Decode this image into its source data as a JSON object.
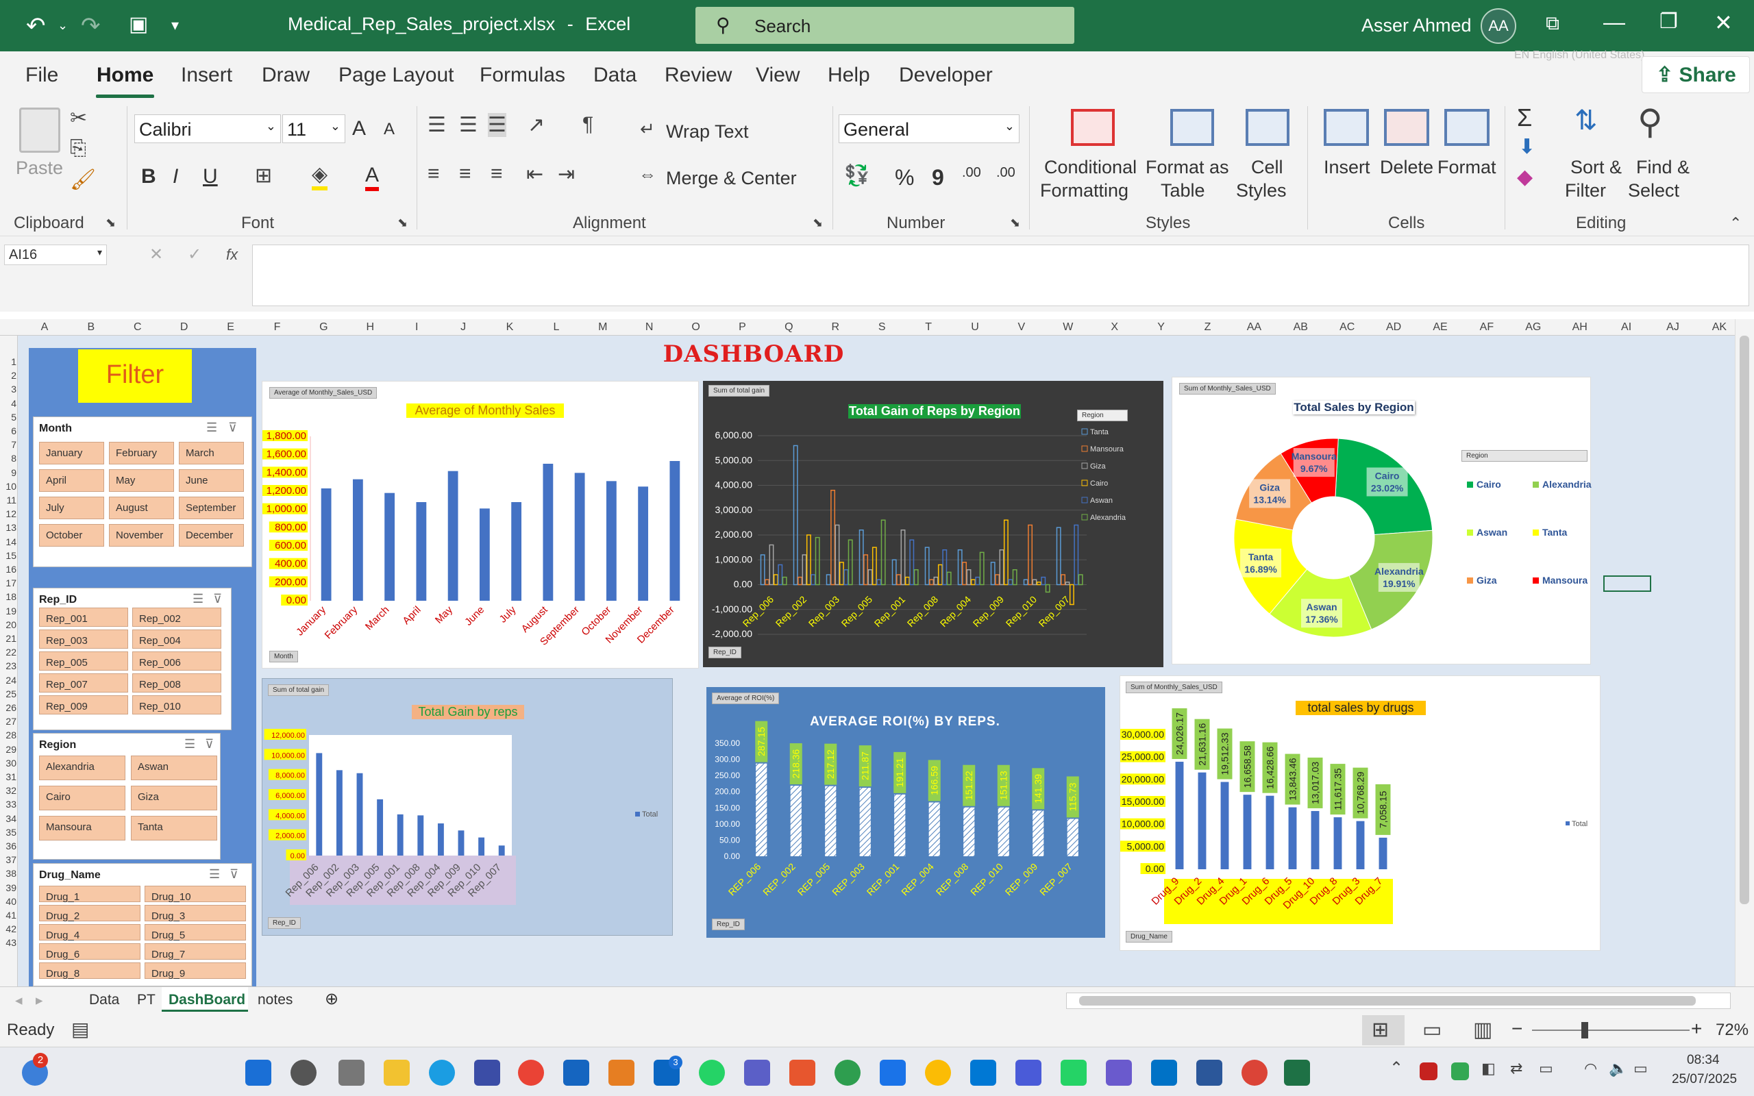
{
  "title_bar": {
    "file_name": "Medical_Rep_Sales_project.xlsx",
    "separator": "-",
    "app_name": "Excel",
    "search_placeholder": "Search",
    "user_name": "Asser Ahmed",
    "user_initials": "AA"
  },
  "menu": {
    "items": [
      "File",
      "Home",
      "Insert",
      "Draw",
      "Page Layout",
      "Formulas",
      "Data",
      "Review",
      "View",
      "Help",
      "Developer"
    ],
    "share_label": "Share",
    "lang_hint": "EN English (United States)"
  },
  "ribbon": {
    "clipboard": {
      "paste": "Paste",
      "label": "Clipboard"
    },
    "font": {
      "name": "Calibri",
      "size": "11",
      "label": "Font",
      "bold": "B",
      "italic": "I",
      "underline": "U",
      "grow": "A",
      "shrink": "A"
    },
    "alignment": {
      "wrap_text": "Wrap Text",
      "merge_center": "Merge & Center",
      "label": "Alignment"
    },
    "number": {
      "format": "General",
      "percent": "%",
      "comma": "9",
      "inc_dec": ".00",
      "label": "Number"
    },
    "styles": {
      "conditional": "Conditional",
      "conditional2": "Formatting",
      "format_as": "Format as",
      "format_as2": "Table",
      "cell": "Cell",
      "cell2": "Styles",
      "label": "Styles"
    },
    "cells": {
      "insert": "Insert",
      "delete": "Delete",
      "format": "Format",
      "label": "Cells"
    },
    "editing": {
      "sort": "Sort &",
      "sort2": "Filter",
      "find": "Find &",
      "find2": "Select",
      "label": "Editing",
      "sigma": "Σ"
    }
  },
  "formula_bar": {
    "name_box": "AI16",
    "fx": "fx",
    "content": ""
  },
  "columns": [
    "A",
    "B",
    "C",
    "D",
    "E",
    "F",
    "G",
    "H",
    "I",
    "J",
    "K",
    "L",
    "M",
    "N",
    "O",
    "P",
    "Q",
    "R",
    "S",
    "T",
    "U",
    "V",
    "W",
    "X",
    "Y",
    "Z",
    "AA",
    "AB",
    "AC",
    "AD",
    "AE",
    "AF",
    "AG",
    "AH",
    "AI",
    "AJ",
    "AK"
  ],
  "rows": [
    "1",
    "2",
    "3",
    "4",
    "5",
    "6",
    "7",
    "8",
    "9",
    "10",
    "11",
    "12",
    "13",
    "14",
    "15",
    "16",
    "17",
    "18",
    "19",
    "20",
    "21",
    "22",
    "23",
    "24",
    "25",
    "26",
    "27",
    "28",
    "29",
    "30",
    "31",
    "32",
    "33",
    "34",
    "35",
    "36",
    "37",
    "38",
    "39",
    "40",
    "41",
    "42",
    "43"
  ],
  "dashboard": {
    "heading": "DASHBOARD",
    "filter_title": "Filter"
  },
  "slicers": {
    "month": {
      "title": "Month",
      "items": [
        "January",
        "February",
        "March",
        "April",
        "May",
        "June",
        "July",
        "August",
        "September",
        "October",
        "November",
        "December"
      ]
    },
    "rep": {
      "title": "Rep_ID",
      "items": [
        "Rep_001",
        "Rep_002",
        "Rep_003",
        "Rep_004",
        "Rep_005",
        "Rep_006",
        "Rep_007",
        "Rep_008",
        "Rep_009",
        "Rep_010"
      ]
    },
    "region": {
      "title": "Region",
      "items": [
        "Alexandria",
        "Aswan",
        "Cairo",
        "Giza",
        "Mansoura",
        "Tanta"
      ]
    },
    "drug": {
      "title": "Drug_Name",
      "items": [
        "Drug_1",
        "Drug_10",
        "Drug_2",
        "Drug_3",
        "Drug_4",
        "Drug_5",
        "Drug_6",
        "Drug_7",
        "Drug_8",
        "Drug_9"
      ]
    }
  },
  "charts": {
    "monthly": {
      "tag": "Average of Monthly_Sales_USD",
      "title": "Average of Monthly Sales",
      "filter": "Month"
    },
    "gain_region": {
      "tag": "Sum of total gain",
      "title": "Total Gain of Reps by Region",
      "filter": "Rep_ID",
      "legend_title": "Region"
    },
    "region_pie": {
      "tag": "Sum of Monthly_Sales_USD",
      "title": "Total Sales by Region",
      "legend_title": "Region"
    },
    "gain_reps": {
      "tag": "Sum of total gain",
      "title": "Total Gain  by reps",
      "filter": "Rep_ID",
      "legend": "Total"
    },
    "roi": {
      "tag": "Average of ROI(%)",
      "title": "AVERAGE ROI(%) BY REPS.",
      "filter": "Rep_ID"
    },
    "drugs": {
      "tag": "Sum of Monthly_Sales_USD",
      "title": "total sales by drugs",
      "filter": "Drug_Name",
      "legend": "Total"
    }
  },
  "chart_data": [
    {
      "type": "bar",
      "title": "Average of Monthly Sales",
      "categories": [
        "January",
        "February",
        "March",
        "April",
        "May",
        "June",
        "July",
        "August",
        "September",
        "October",
        "November",
        "December"
      ],
      "values": [
        1230,
        1330,
        1180,
        1080,
        1420,
        1010,
        1080,
        1500,
        1400,
        1310,
        1250,
        1530
      ],
      "ylim": [
        0,
        1800
      ],
      "yticks": [
        "0.00",
        "200.00",
        "400.00",
        "600.00",
        "800.00",
        "1,000.00",
        "1,200.00",
        "1,400.00",
        "1,600.00",
        "1,800.00"
      ]
    },
    {
      "type": "bar",
      "title": "Total Gain of Reps by Region",
      "categories": [
        "Rep_006",
        "Rep_002",
        "Rep_003",
        "Rep_005",
        "Rep_001",
        "Rep_008",
        "Rep_004",
        "Rep_009",
        "Rep_010",
        "Rep_007"
      ],
      "series": [
        {
          "name": "Tanta",
          "values": [
            1200,
            5600,
            400,
            2200,
            1000,
            1500,
            1400,
            900,
            200,
            2300
          ]
        },
        {
          "name": "Mansoura",
          "values": [
            200,
            300,
            3800,
            1200,
            400,
            200,
            900,
            400,
            2400,
            400
          ]
        },
        {
          "name": "Giza",
          "values": [
            1600,
            1200,
            2400,
            600,
            2200,
            300,
            600,
            1400,
            200,
            100
          ]
        },
        {
          "name": "Cairo",
          "values": [
            400,
            2000,
            900,
            1500,
            300,
            800,
            200,
            2600,
            100,
            -800
          ]
        },
        {
          "name": "Aswan",
          "values": [
            800,
            400,
            600,
            200,
            1800,
            1400,
            300,
            200,
            300,
            2400
          ]
        },
        {
          "name": "Alexandria",
          "values": [
            300,
            1900,
            1800,
            2600,
            600,
            500,
            1300,
            600,
            -300,
            400
          ]
        }
      ],
      "ylim": [
        -2000,
        6000
      ],
      "yticks": [
        "-2,000.00",
        "-1,000.00",
        "0.00",
        "1,000.00",
        "2,000.00",
        "3,000.00",
        "4,000.00",
        "5,000.00",
        "6,000.00"
      ]
    },
    {
      "type": "pie",
      "title": "Total Sales by Region",
      "series": [
        {
          "name": "Cairo",
          "value": 23.02,
          "label": "23.02%"
        },
        {
          "name": "Alexandria",
          "value": 19.91,
          "label": "19.91%"
        },
        {
          "name": "Aswan",
          "value": 17.36,
          "label": "17.36%"
        },
        {
          "name": "Tanta",
          "value": 16.89,
          "label": "16.89%"
        },
        {
          "name": "Giza",
          "value": 13.14,
          "label": "13.14%"
        },
        {
          "name": "Mansoura",
          "value": 9.67,
          "label": "9.67%"
        }
      ]
    },
    {
      "type": "bar",
      "title": "Total Gain  by reps",
      "categories": [
        "Rep_006",
        "Rep_002",
        "Rep_003",
        "Rep_005",
        "Rep_001",
        "Rep_008",
        "Rep_004",
        "Rep_009",
        "Rep_010",
        "Rep_007"
      ],
      "values": [
        10200,
        8500,
        8200,
        5600,
        4100,
        4000,
        3200,
        2500,
        1800,
        1000
      ],
      "ylim": [
        0,
        12000
      ],
      "yticks": [
        "0.00",
        "2,000.00",
        "4,000.00",
        "6,000.00",
        "8,000.00",
        "10,000.00",
        "12,000.00"
      ]
    },
    {
      "type": "bar",
      "title": "AVERAGE ROI(%) BY REPS.",
      "categories": [
        "REP_006",
        "REP_002",
        "REP_005",
        "REP_003",
        "REP_001",
        "REP_004",
        "REP_008",
        "REP_010",
        "REP_009",
        "REP_007"
      ],
      "values": [
        287.15,
        218.36,
        217.12,
        211.87,
        191.21,
        166.59,
        151.22,
        151.13,
        141.39,
        115.73
      ],
      "labels": [
        "287.15",
        "218.36",
        "217.12",
        "211.87",
        "191.21",
        "166.59",
        "151.22",
        "151.13",
        "141.39",
        "115.73"
      ],
      "ylim": [
        0,
        350
      ],
      "yticks": [
        "0.00",
        "50.00",
        "100.00",
        "150.00",
        "200.00",
        "250.00",
        "300.00",
        "350.00"
      ]
    },
    {
      "type": "bar",
      "title": "total sales by drugs",
      "categories": [
        "Drug_9",
        "Drug_2",
        "Drug_4",
        "Drug_1",
        "Drug_6",
        "Drug_5",
        "Drug_10",
        "Drug_8",
        "Drug_3",
        "Drug_7"
      ],
      "values": [
        24026.17,
        21631.16,
        19512.33,
        16658.58,
        16428.66,
        13843.46,
        13017.03,
        11617.35,
        10768.29,
        7058.15
      ],
      "labels": [
        "24,026.17",
        "21,631.16",
        "19,512.33",
        "16,658.58",
        "16,428.66",
        "13,843.46",
        "13,017.03",
        "11,617.35",
        "10,768.29",
        "7,058.15"
      ],
      "ylim": [
        0,
        30000
      ],
      "yticks": [
        "0.00",
        "5,000.00",
        "10,000.00",
        "15,000.00",
        "20,000.00",
        "25,000.00",
        "30,000.00"
      ]
    }
  ],
  "sheet_tabs": [
    "Data",
    "PT",
    "DashBoard",
    "notes"
  ],
  "status": {
    "ready": "Ready",
    "zoom": "72%"
  },
  "taskbar": {
    "time": "08:34",
    "date": "25/07/2025",
    "badge": "2",
    "outlook_badge": "3"
  }
}
